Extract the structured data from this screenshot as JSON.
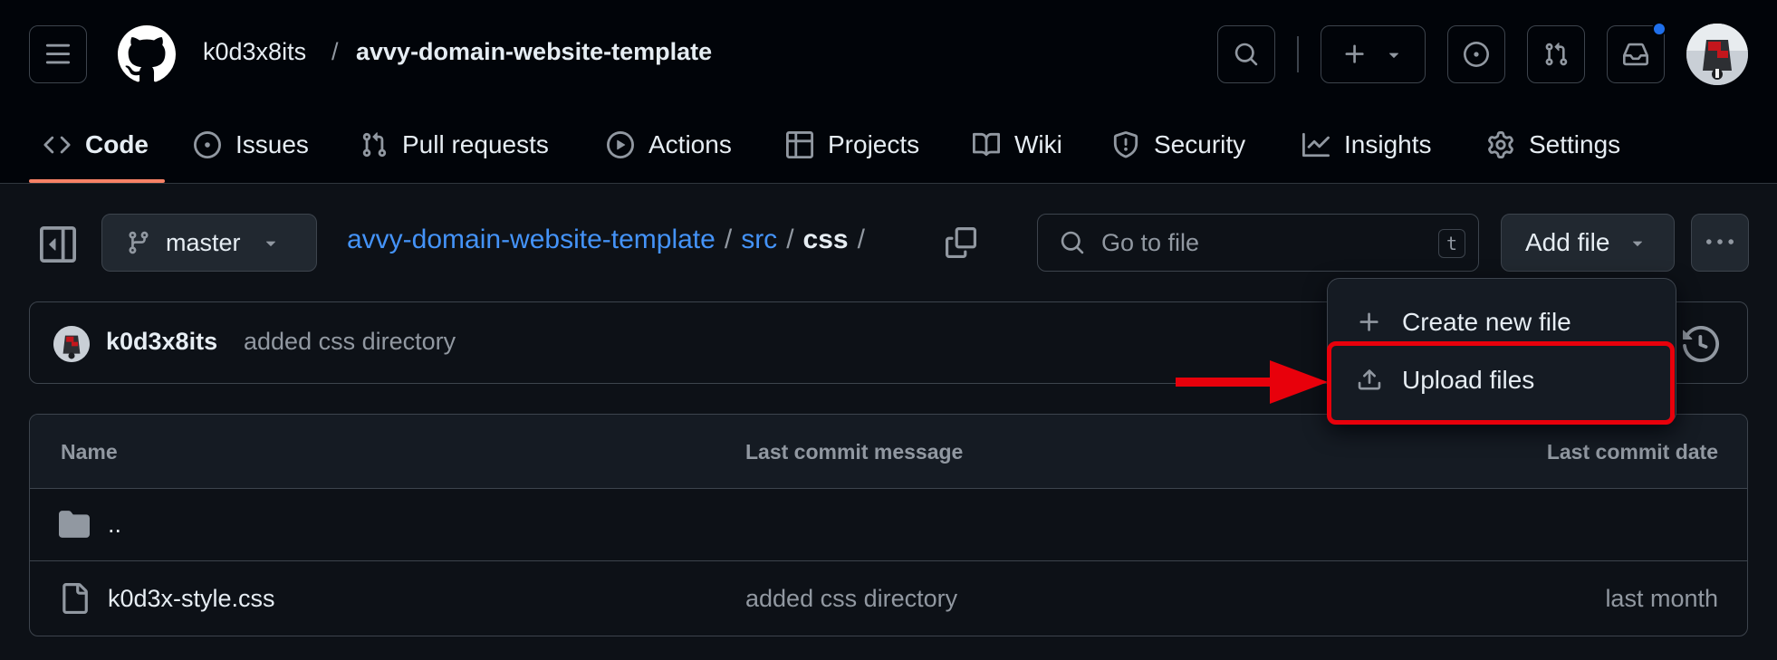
{
  "header": {
    "owner": "k0d3x8its",
    "separator": "/",
    "repo": "avvy-domain-website-template"
  },
  "nav": {
    "tabs": [
      {
        "label": "Code",
        "icon": "code-icon"
      },
      {
        "label": "Issues",
        "icon": "issue-icon"
      },
      {
        "label": "Pull requests",
        "icon": "pull-request-icon"
      },
      {
        "label": "Actions",
        "icon": "play-icon"
      },
      {
        "label": "Projects",
        "icon": "table-icon"
      },
      {
        "label": "Wiki",
        "icon": "book-icon"
      },
      {
        "label": "Security",
        "icon": "shield-icon"
      },
      {
        "label": "Insights",
        "icon": "graph-icon"
      },
      {
        "label": "Settings",
        "icon": "gear-icon"
      }
    ]
  },
  "toolbar": {
    "branch": "master",
    "path_repo": "avvy-domain-website-template",
    "path_sep": "/",
    "path_src": "src",
    "path_current": "css",
    "goto_placeholder": "Go to file",
    "goto_shortcut": "t",
    "add_file_label": "Add file"
  },
  "commit": {
    "author": "k0d3x8its",
    "message": "added css directory"
  },
  "table": {
    "headers": {
      "name": "Name",
      "message": "Last commit message",
      "date": "Last commit date"
    },
    "rows": [
      {
        "name": "..",
        "message": "",
        "date": "",
        "icon": "folder-icon"
      },
      {
        "name": "k0d3x-style.css",
        "message": "added css directory",
        "date": "last month",
        "icon": "file-icon"
      }
    ]
  },
  "dropdown": {
    "items": [
      {
        "label": "Create new file",
        "icon": "plus-icon"
      },
      {
        "label": "Upload files",
        "icon": "upload-icon"
      }
    ]
  },
  "colors": {
    "accent_link": "#4493f8",
    "active_tab_underline": "#f78166",
    "annotation_red": "#e8000b",
    "notification_dot": "#1f6feb"
  }
}
